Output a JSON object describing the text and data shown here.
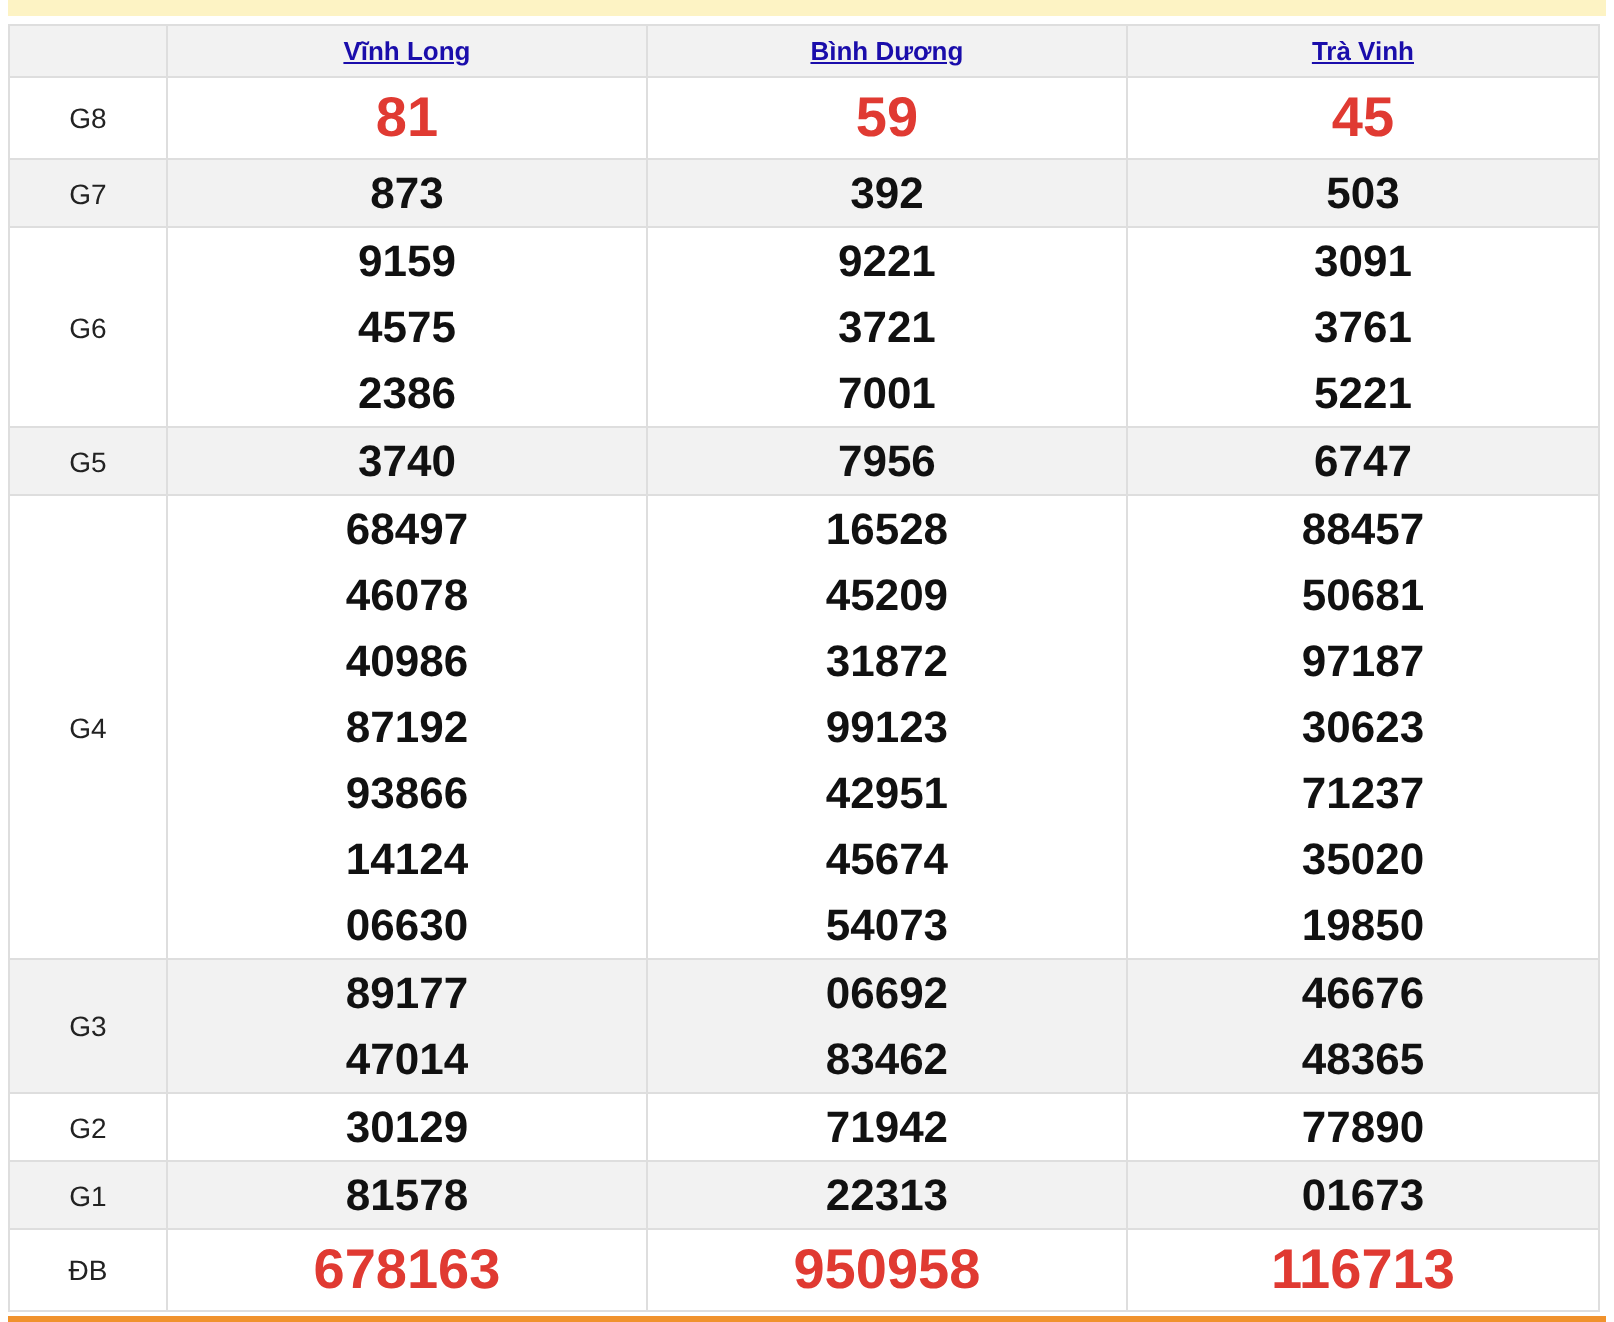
{
  "provinces": [
    "Vĩnh Long",
    "Bình Dương",
    "Trà Vinh"
  ],
  "rows": [
    {
      "prize": "G8",
      "kind": "highlight",
      "values": [
        [
          "81"
        ],
        [
          "59"
        ],
        [
          "45"
        ]
      ]
    },
    {
      "prize": "G7",
      "kind": "normal",
      "values": [
        [
          "873"
        ],
        [
          "392"
        ],
        [
          "503"
        ]
      ]
    },
    {
      "prize": "G6",
      "kind": "normal",
      "values": [
        [
          "9159",
          "4575",
          "2386"
        ],
        [
          "9221",
          "3721",
          "7001"
        ],
        [
          "3091",
          "3761",
          "5221"
        ]
      ]
    },
    {
      "prize": "G5",
      "kind": "normal",
      "values": [
        [
          "3740"
        ],
        [
          "7956"
        ],
        [
          "6747"
        ]
      ]
    },
    {
      "prize": "G4",
      "kind": "normal",
      "values": [
        [
          "68497",
          "46078",
          "40986",
          "87192",
          "93866",
          "14124",
          "06630"
        ],
        [
          "16528",
          "45209",
          "31872",
          "99123",
          "42951",
          "45674",
          "54073"
        ],
        [
          "88457",
          "50681",
          "97187",
          "30623",
          "71237",
          "35020",
          "19850"
        ]
      ]
    },
    {
      "prize": "G3",
      "kind": "normal",
      "values": [
        [
          "89177",
          "47014"
        ],
        [
          "06692",
          "83462"
        ],
        [
          "46676",
          "48365"
        ]
      ]
    },
    {
      "prize": "G2",
      "kind": "normal",
      "values": [
        [
          "30129"
        ],
        [
          "71942"
        ],
        [
          "77890"
        ]
      ]
    },
    {
      "prize": "G1",
      "kind": "normal",
      "values": [
        [
          "81578"
        ],
        [
          "22313"
        ],
        [
          "01673"
        ]
      ]
    },
    {
      "prize": "ĐB",
      "kind": "highlight",
      "values": [
        [
          "678163"
        ],
        [
          "950958"
        ],
        [
          "116713"
        ]
      ]
    }
  ]
}
